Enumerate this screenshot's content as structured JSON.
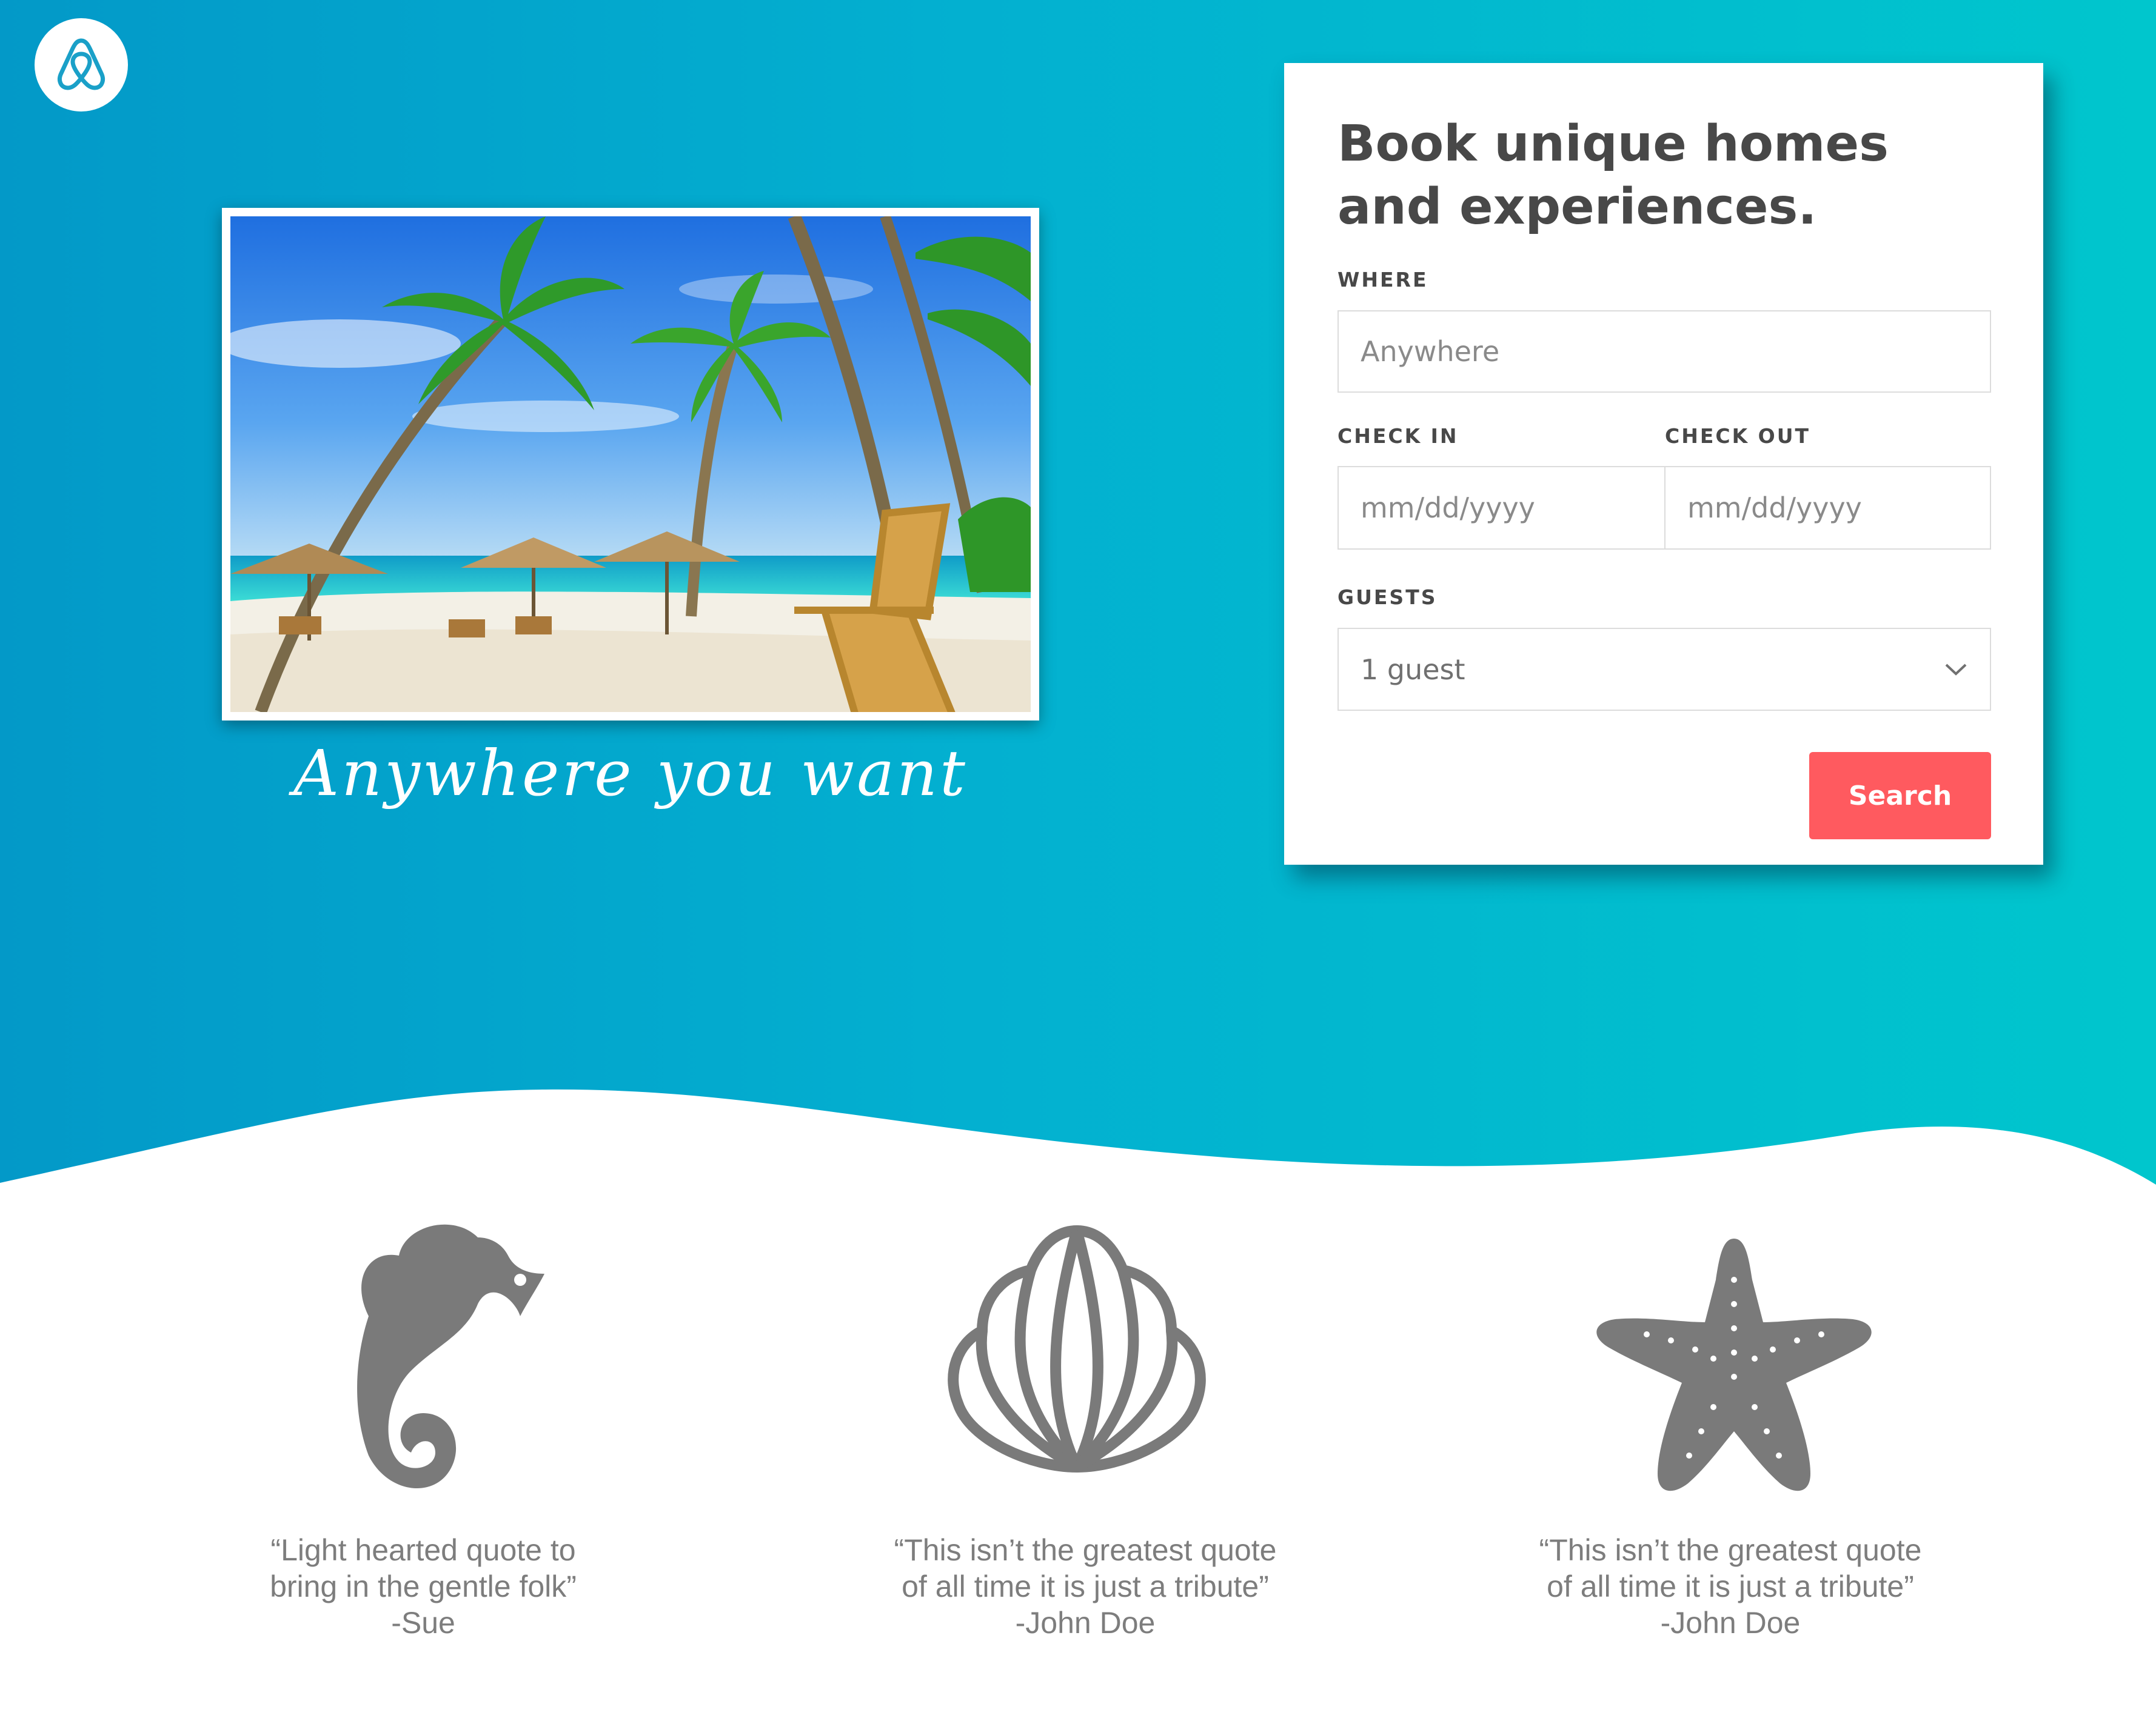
{
  "brand": {
    "logo_icon": "airbnb-belo-icon",
    "accent": "#ff5a5f",
    "hero_gradient": [
      "#0399c8",
      "#00c6cd"
    ]
  },
  "hero": {
    "image_alt": "tropical beach with palm trees and lounge chair",
    "tagline": "Anywhere you want"
  },
  "booking": {
    "heading": "Book unique homes and experiences.",
    "where": {
      "label": "WHERE",
      "placeholder": "Anywhere"
    },
    "check_in": {
      "label": "CHECK IN",
      "placeholder": "mm/dd/yyyy"
    },
    "check_out": {
      "label": "CHECK OUT",
      "placeholder": "mm/dd/yyyy"
    },
    "guests": {
      "label": "GUESTS",
      "value": "1 guest",
      "icon": "chevron-down-icon"
    },
    "search_label": "Search"
  },
  "testimonials": [
    {
      "icon": "seahorse-icon",
      "line1": "“Light hearted quote to",
      "line2": "bring in the gentle folk”",
      "author": "-Sue"
    },
    {
      "icon": "seashell-icon",
      "line1": "“This isn’t the greatest quote",
      "line2": "of all time it is just a tribute”",
      "author": "-John Doe"
    },
    {
      "icon": "starfish-icon",
      "line1": "“This isn’t the greatest quote",
      "line2": "of all time it is just a tribute”",
      "author": "-John Doe"
    }
  ]
}
